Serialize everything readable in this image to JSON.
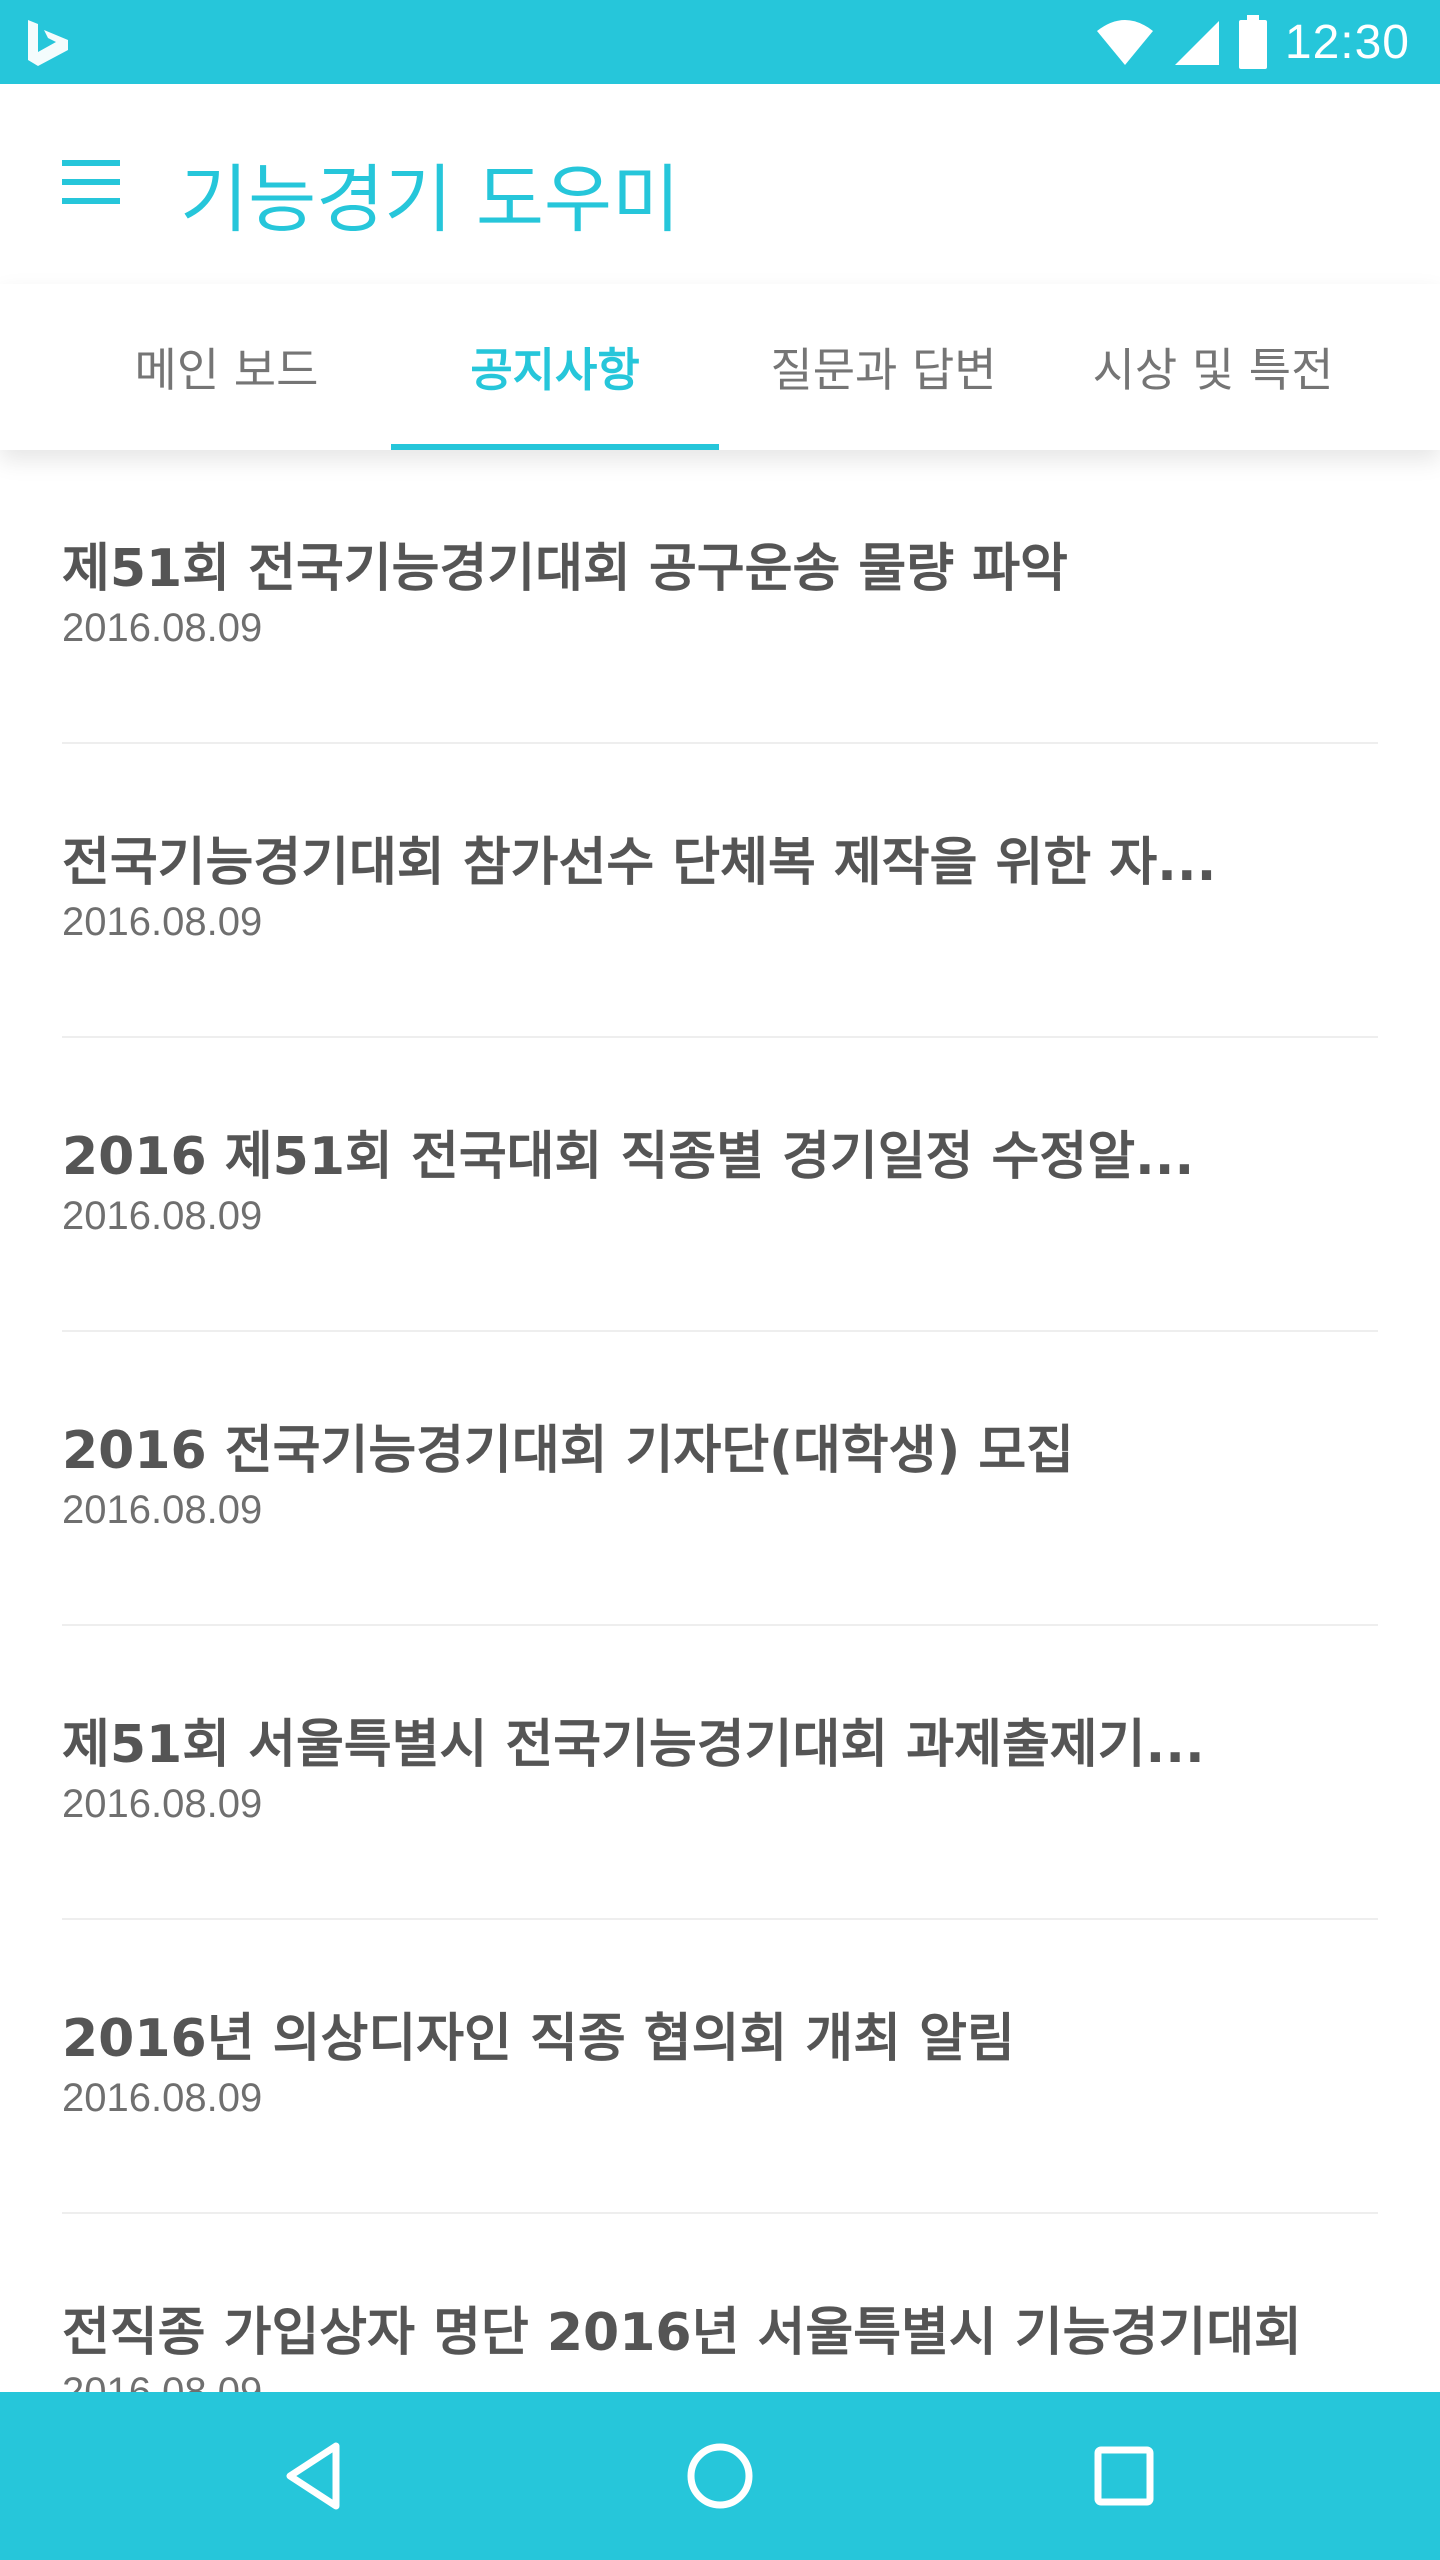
{
  "status_bar": {
    "time": "12:30"
  },
  "app_bar": {
    "title": "기능경기 도우미"
  },
  "tabs": [
    {
      "label": "메인 보드",
      "active": false
    },
    {
      "label": "공지사항",
      "active": true
    },
    {
      "label": "질문과 답변",
      "active": false
    },
    {
      "label": "시상 및 특전",
      "active": false
    }
  ],
  "notices": [
    {
      "title": "제51회 전국기능경기대회 공구운송 물량 파악",
      "date": "2016.08.09"
    },
    {
      "title": "전국기능경기대회 참가선수 단체복 제작을 위한 자...",
      "date": "2016.08.09"
    },
    {
      "title": "2016 제51회 전국대회 직종별 경기일정 수정알...",
      "date": "2016.08.09"
    },
    {
      "title": "2016 전국기능경기대회 기자단(대학생) 모집",
      "date": "2016.08.09"
    },
    {
      "title": "제51회 서울특별시 전국기능경기대회 과제출제기...",
      "date": "2016.08.09"
    },
    {
      "title": "2016년 의상디자인 직종 협의회 개최 알림",
      "date": "2016.08.09"
    },
    {
      "title": "전직종 가입상자 명단 2016년 서울특별시 기능경기대회",
      "date": "2016.08.09"
    }
  ],
  "colors": {
    "accent": "#26c6da",
    "title_text": "#555555",
    "date_text": "#6f6f6f",
    "inactive_tab": "#757575"
  },
  "icons": {
    "status_logo": "bing-logo-icon",
    "wifi": "wifi-icon",
    "signal": "cell-signal-icon",
    "battery": "battery-icon",
    "menu": "hamburger-menu-icon",
    "back": "back-triangle-icon",
    "home": "home-circle-icon",
    "recents": "recents-square-icon"
  }
}
